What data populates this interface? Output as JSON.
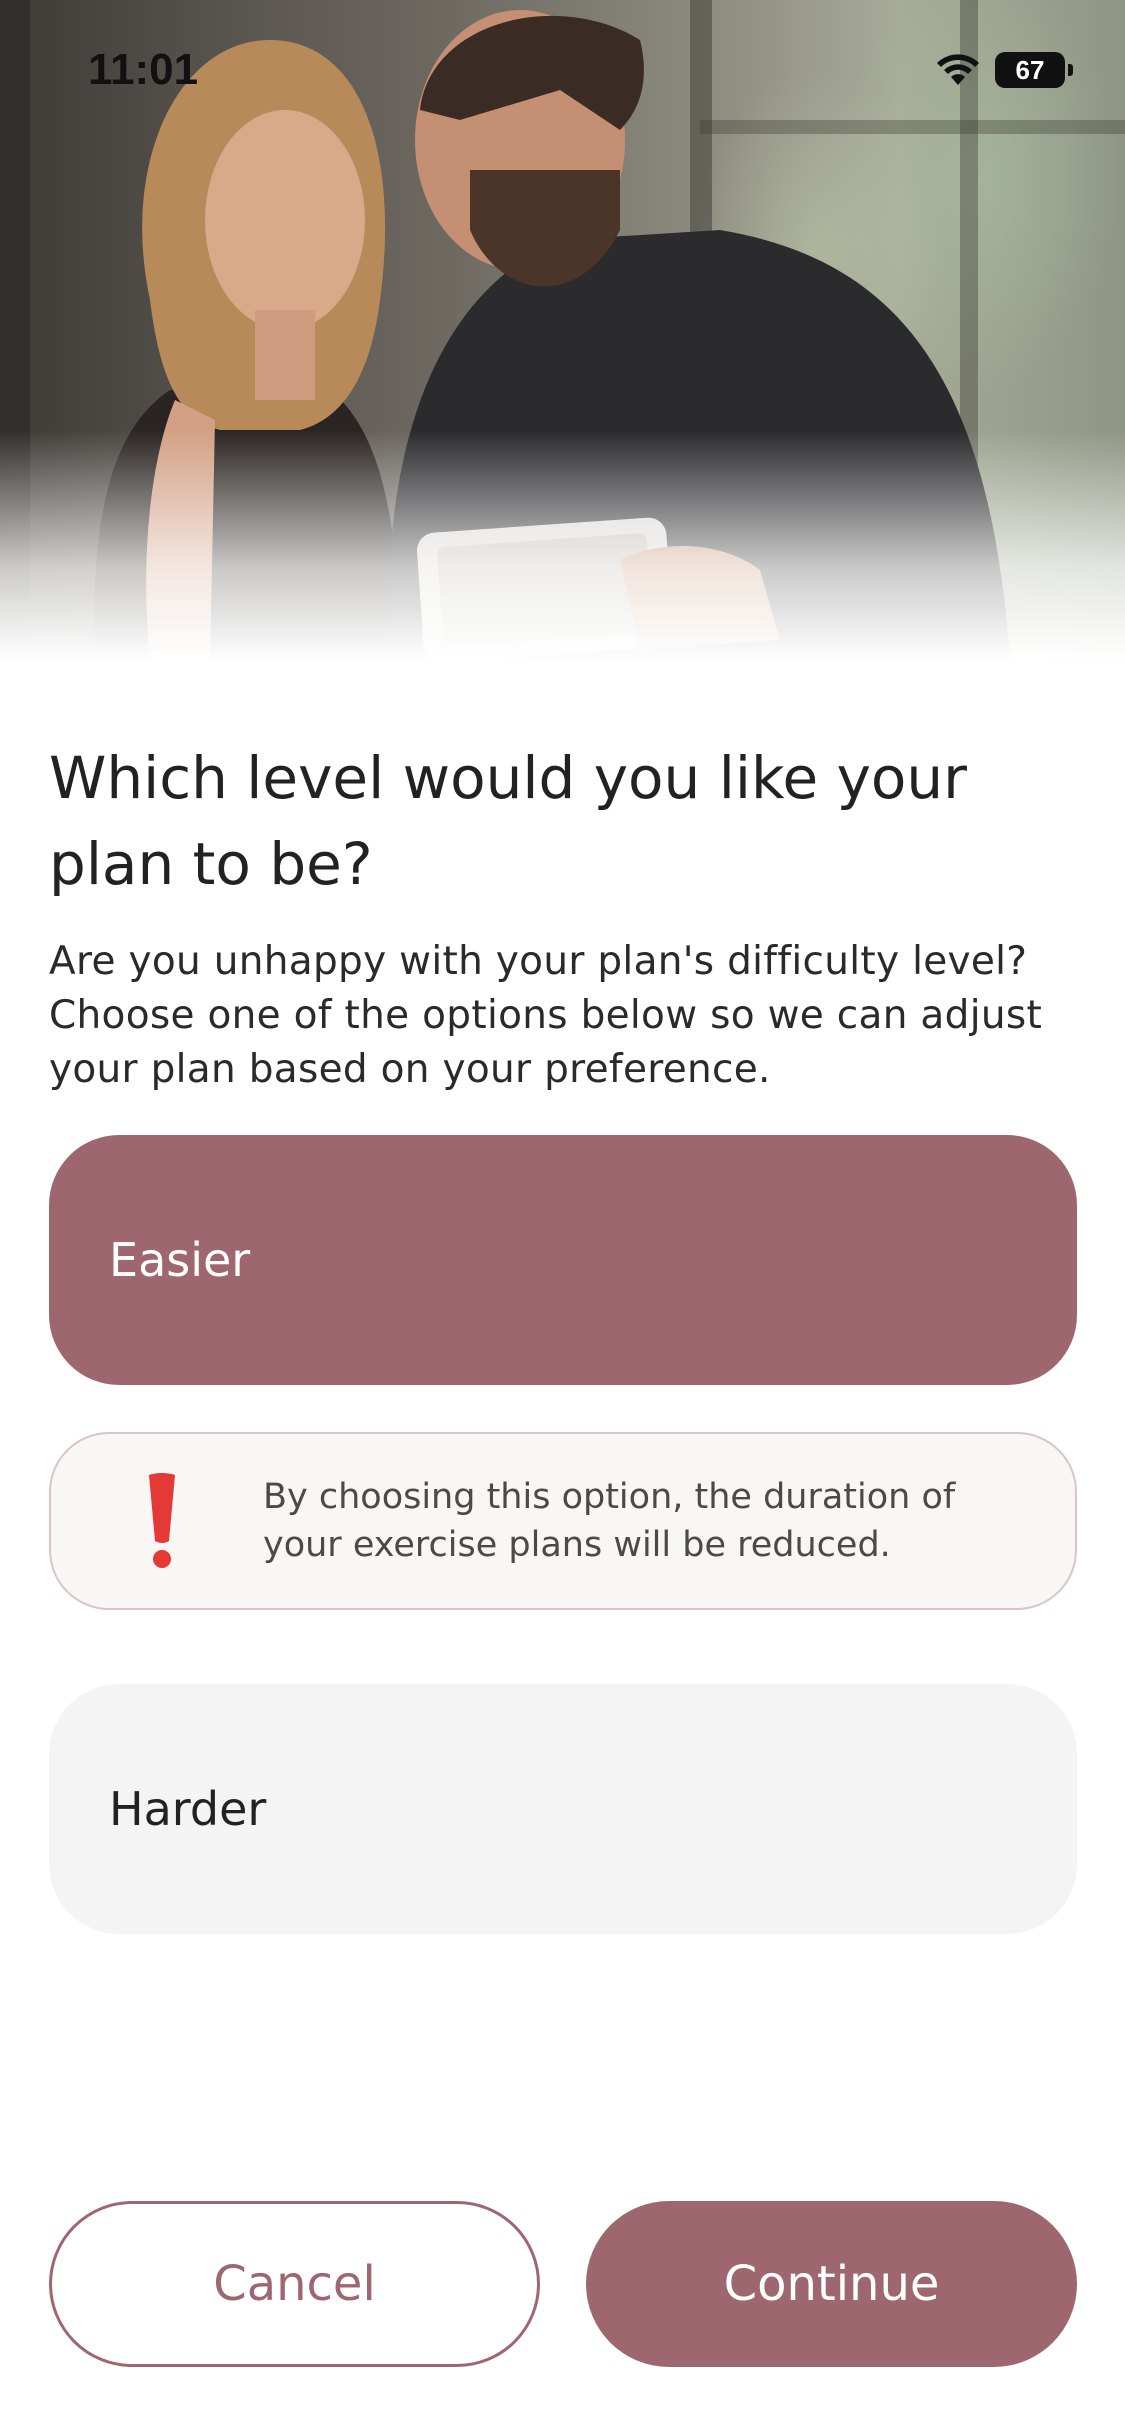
{
  "status_bar": {
    "time": "11:01",
    "battery": "67",
    "icons": [
      "wifi-icon",
      "battery-icon"
    ]
  },
  "hero": {
    "image": "couple-at-gym-with-tablet-photo"
  },
  "question": {
    "title": "Which level would you like your plan to be?",
    "description": "Are you unhappy with your plan's difficulty level? Choose one of the options below so we can adjust your plan based on your preference."
  },
  "options": [
    {
      "label": "Easier",
      "selected": true
    },
    {
      "label": "Harder",
      "selected": false
    }
  ],
  "notice": {
    "icon": "exclamation-icon",
    "text": "By choosing this option, the duration of your exercise plans will be reduced."
  },
  "actions": {
    "cancel_label": "Cancel",
    "continue_label": "Continue"
  },
  "colors": {
    "accent": "#9e6770",
    "option_bg": "#f5f4f4",
    "alert_red": "#e53935"
  }
}
